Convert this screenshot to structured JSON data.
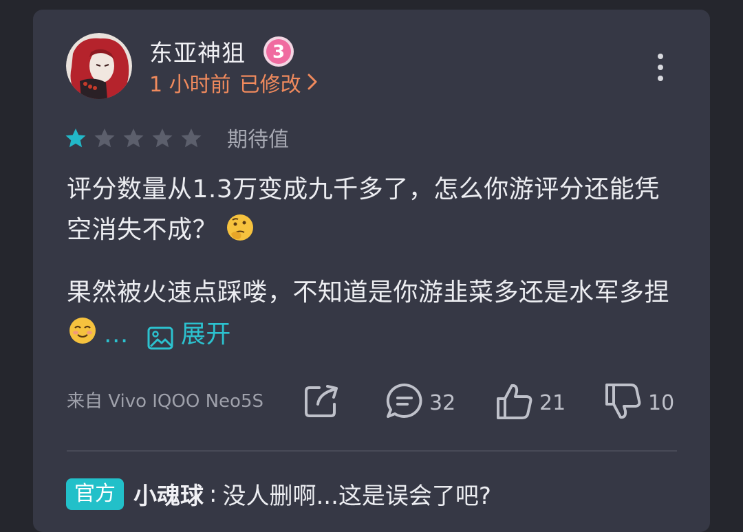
{
  "review": {
    "author": "东亚神狙",
    "level": "3",
    "time": "1 小时前",
    "edited": "已修改",
    "rating": 1,
    "rating_max": 5,
    "rating_label": "期待值",
    "paragraph1": "评分数量从1.3万变成九千多了，怎么你游评分还能凭空消失不成？",
    "paragraph2": "果然被火速点踩喽，不知道是你游韭菜多还是水军多捏",
    "ellipsis": "...",
    "expand_label": "展开",
    "device": "来自 Vivo IQOO Neo5S",
    "comments": "32",
    "likes": "21",
    "dislikes": "10"
  },
  "reply": {
    "tag": "官方",
    "name": "小魂球",
    "separator": ":",
    "text": "没人删啊...这是误会了吧?"
  },
  "colors": {
    "background": "#25262d",
    "card": "#363845",
    "accent_orange": "#f08a5d",
    "accent_teal": "#2cc2cf",
    "star_active": "#22b8c8",
    "star_inactive": "#5c5f6c",
    "badge_pink": "#f06ba0"
  },
  "icons": [
    "avatar",
    "level-badge-icon",
    "more-icon",
    "star-icon",
    "thinking-emoji",
    "smiling-emoji",
    "image-icon",
    "share-icon",
    "comment-icon",
    "thumbs-up-icon",
    "thumbs-down-icon"
  ]
}
